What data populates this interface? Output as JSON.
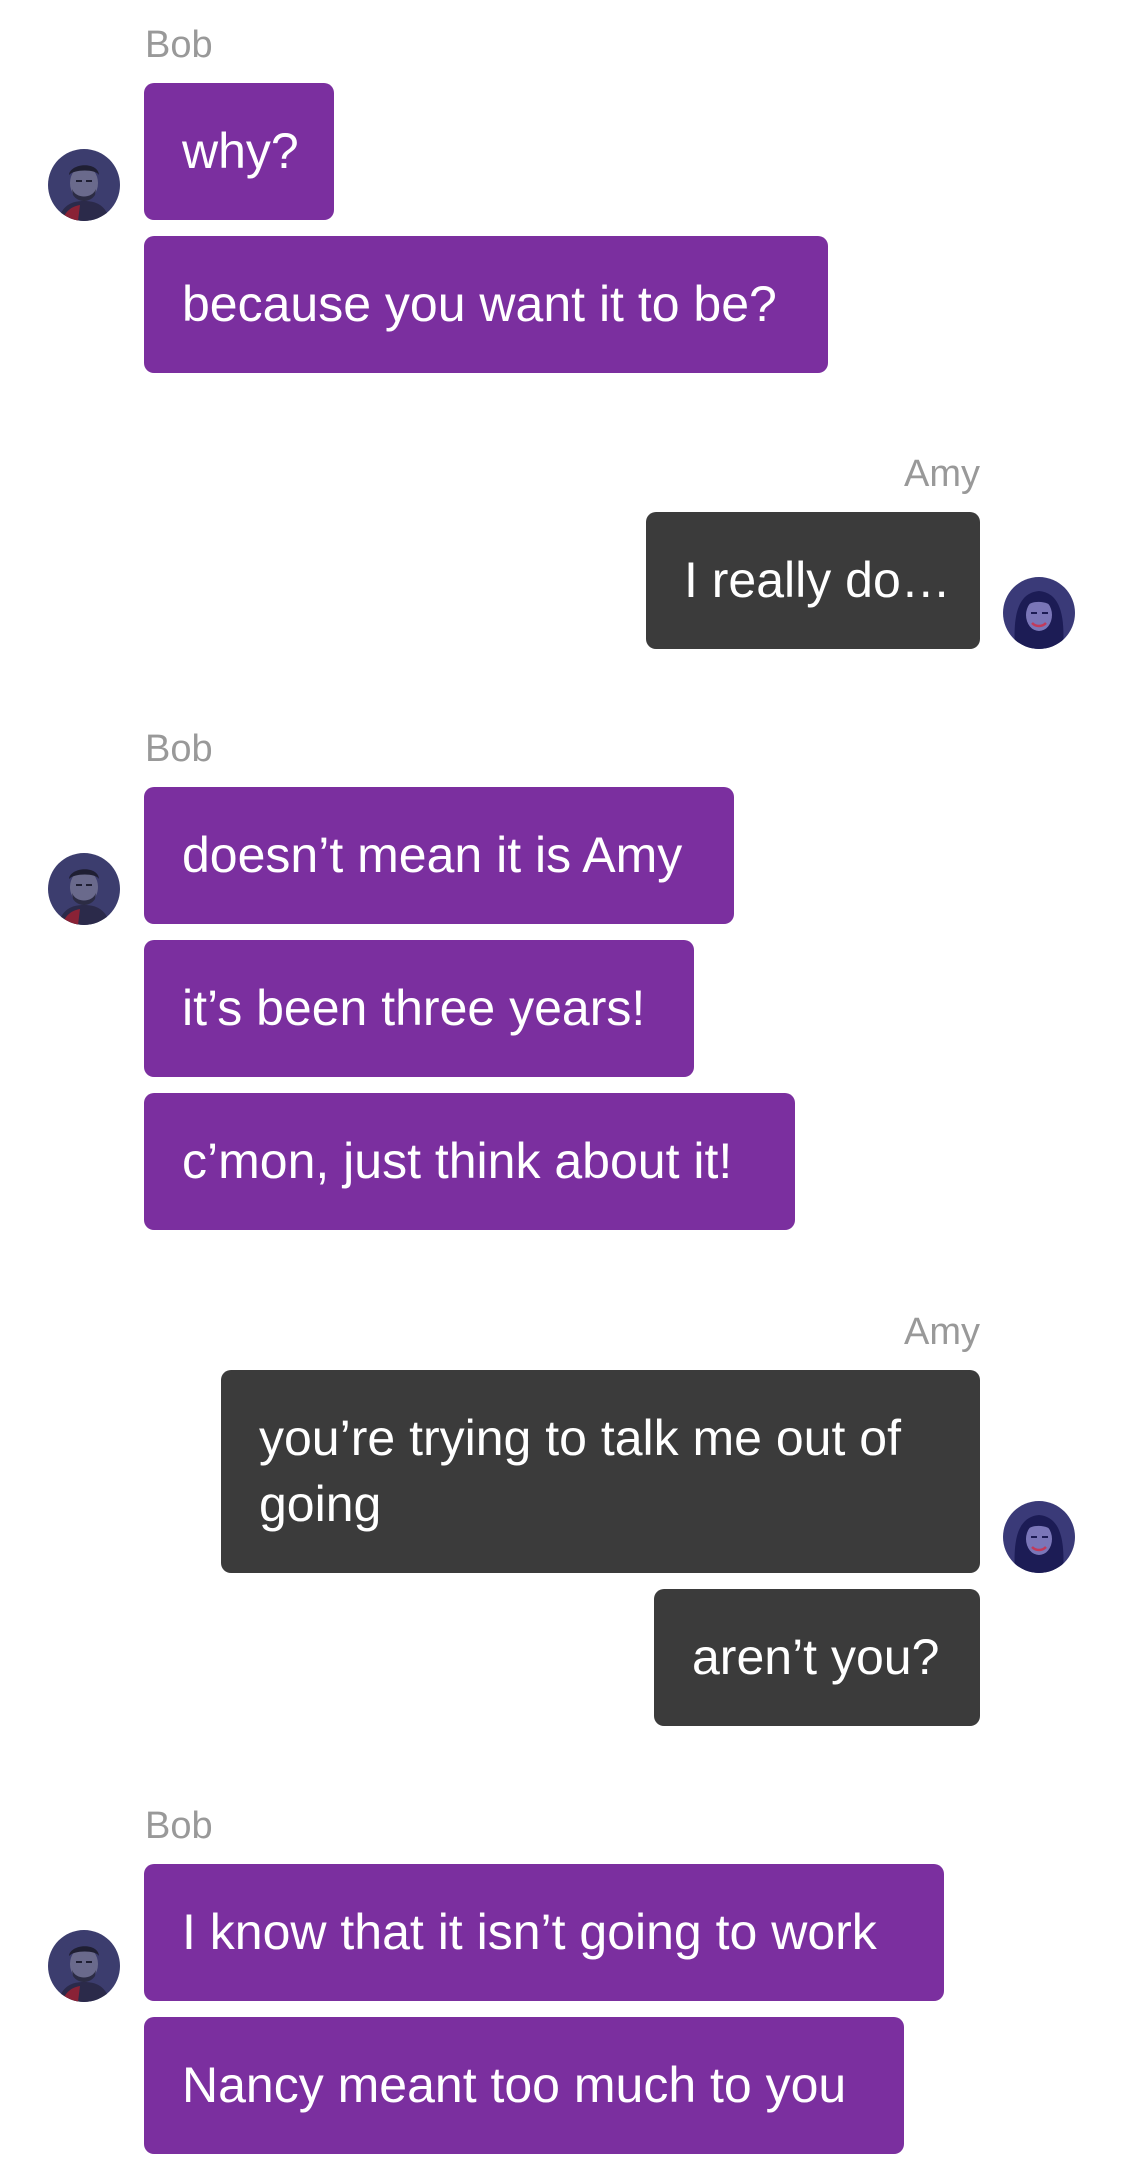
{
  "colors": {
    "bob_bubble": "#7b2f9f",
    "amy_bubble": "#3b3b3b",
    "sender_name": "#999999",
    "background": "#ffffff"
  },
  "avatars": {
    "bob": "man-portrait-avatar",
    "amy": "woman-portrait-avatar"
  },
  "groups": [
    {
      "sender": "Bob",
      "messages": [
        "why?",
        "because you want it to be?"
      ]
    },
    {
      "sender": "Amy",
      "messages": [
        "I really do…"
      ]
    },
    {
      "sender": "Bob",
      "messages": [
        "doesn’t mean it is Amy",
        "it’s been three years!",
        "c’mon, just think about it!"
      ]
    },
    {
      "sender": "Amy",
      "messages": [
        "you’re trying to talk me out of going",
        "aren’t you?"
      ]
    },
    {
      "sender": "Bob",
      "messages": [
        "I know that it isn’t going to work",
        "Nancy meant too much to you"
      ]
    }
  ]
}
